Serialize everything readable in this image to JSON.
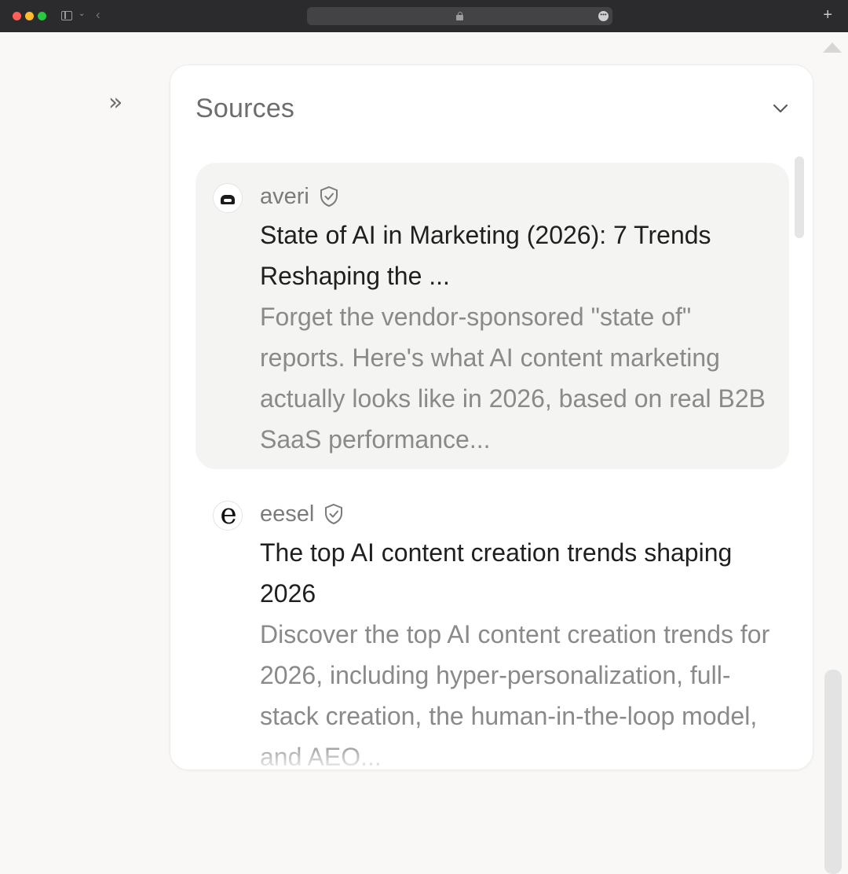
{
  "browser": {
    "controls": [
      "close",
      "minimize",
      "maximize"
    ],
    "icons": [
      "sidebar-toggle-icon",
      "back-icon",
      "lock-icon",
      "more-icon",
      "new-tab-icon"
    ],
    "new_tab_label": "+"
  },
  "sidebar": {
    "expand_icon": "»"
  },
  "sources_panel": {
    "title": "Sources",
    "items": [
      {
        "site": "averi",
        "verified": true,
        "title": "State of AI in Marketing (2026): 7 Trends Reshaping the ...",
        "description": "Forget the vendor-sponsored \"state of\" reports. Here's what AI content marketing actually looks like in 2026, based on real B2B SaaS performance..."
      },
      {
        "site": "eesel",
        "favicon_letter": "e",
        "verified": true,
        "title": "The top AI content creation trends shaping 2026",
        "description": "Discover the top AI content creation trends for 2026, including hyper-personalization, full-stack creation, the human-in-the-loop model, and AEO..."
      }
    ]
  }
}
